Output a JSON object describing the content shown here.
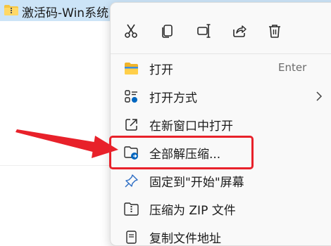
{
  "file": {
    "name": "激活码-Win系统.zi",
    "icon": "zip-folder-icon"
  },
  "toolbar": {
    "buttons": [
      {
        "name": "cut-icon"
      },
      {
        "name": "copy-icon"
      },
      {
        "name": "rename-icon"
      },
      {
        "name": "share-icon"
      },
      {
        "name": "delete-icon"
      }
    ]
  },
  "menu": {
    "items": [
      {
        "label": "打开",
        "shortcut": "Enter",
        "icon": "folder-open-icon"
      },
      {
        "label": "打开方式",
        "icon": "open-with-icon",
        "submenu": true
      },
      {
        "label": "在新窗口中打开",
        "icon": "new-window-icon"
      },
      {
        "label": "全部解压缩...",
        "icon": "extract-all-icon"
      },
      {
        "label": "固定到\"开始\"屏幕",
        "icon": "pin-icon"
      },
      {
        "label": "压缩为 ZIP 文件",
        "icon": "zip-file-icon"
      },
      {
        "label": "复制文件地址",
        "icon": "copy-path-icon"
      }
    ]
  },
  "colors": {
    "highlight": "#e8212a",
    "selection": "#cce4f7",
    "accent": "#0067c0"
  }
}
